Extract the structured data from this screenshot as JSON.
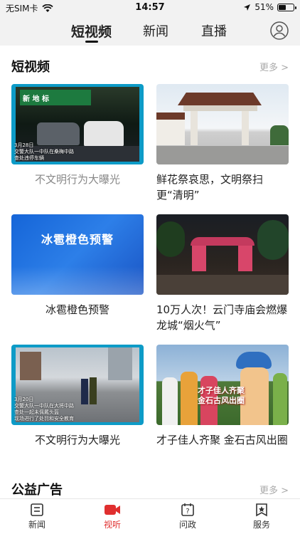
{
  "status_bar": {
    "carrier": "无SIM卡",
    "time": "14:57",
    "battery": "51%",
    "battery_level": 0.51
  },
  "top_nav": {
    "tabs": [
      {
        "label": "短视频",
        "active": true
      },
      {
        "label": "新闻",
        "active": false
      },
      {
        "label": "直播",
        "active": false
      }
    ]
  },
  "sections": {
    "short_video": {
      "title": "短视频",
      "more": "更多 >"
    },
    "psa": {
      "title": "公益广告",
      "more": "更多 >"
    }
  },
  "cards": [
    {
      "caption": "不文明行为大曝光",
      "thumb_text": [
        "3月28日",
        "交警大队一中队在桑梅中路",
        "查处违停车辆"
      ],
      "sign": "新 地 标"
    },
    {
      "caption": "鲜花祭哀思，文明祭扫更“清明”"
    },
    {
      "caption": "冰雹橙色预警",
      "thumb_text": [
        "冰雹橙色预警"
      ]
    },
    {
      "caption": "10万人次！云门寺庙会燃爆龙城“烟火气”"
    },
    {
      "caption": "不文明行为大曝光",
      "thumb_text": [
        "3月20日",
        "交警大队一中队在大将中路",
        "查处一起未佩戴头盔",
        "现场进行了处罚和安全教育"
      ]
    },
    {
      "caption": "才子佳人齐聚 金石古风出圈",
      "thumb_text": [
        "才子佳人齐聚",
        "金石古风出圈"
      ]
    }
  ],
  "bottom_bar": {
    "items": [
      {
        "label": "新闻",
        "icon": "news-icon",
        "active": false
      },
      {
        "label": "视听",
        "icon": "video-icon",
        "active": true
      },
      {
        "label": "问政",
        "icon": "question-icon",
        "active": false
      },
      {
        "label": "服务",
        "icon": "service-icon",
        "active": false
      }
    ]
  },
  "colors": {
    "accent": "#e02f2f",
    "background": "#f2f2f2"
  }
}
